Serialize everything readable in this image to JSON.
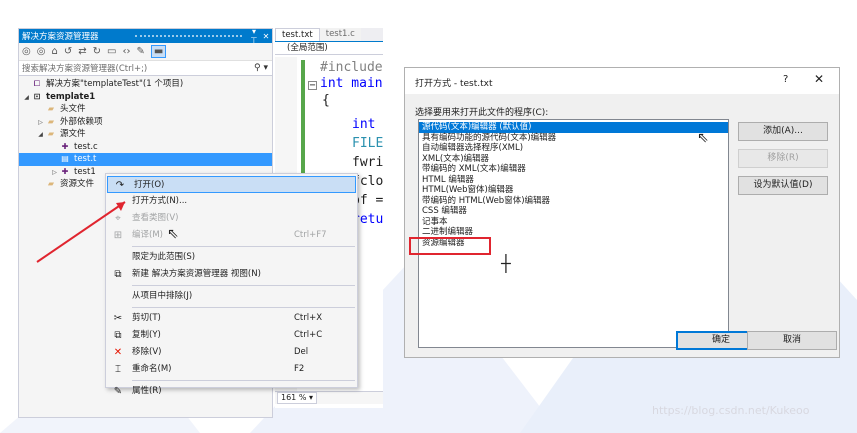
{
  "solution_explorer": {
    "title": "解决方案资源管理器",
    "pin_label": "▾ ⊤",
    "close_label": "✕",
    "search_placeholder": "搜索解决方案资源管理器(Ctrl+;)",
    "tree": [
      {
        "label": "解决方案\"templateTest\"(1 个项目)",
        "level": 0,
        "icon": "solution-icon",
        "expand": ""
      },
      {
        "label": "template1",
        "level": 0,
        "icon": "project-icon",
        "expand": "open",
        "bold": true
      },
      {
        "label": "头文件",
        "level": 1,
        "icon": "folder-icon",
        "expand": ""
      },
      {
        "label": "外部依赖项",
        "level": 1,
        "icon": "folder-icon",
        "expand": "closed"
      },
      {
        "label": "源文件",
        "level": 1,
        "icon": "folder-icon",
        "expand": "open"
      },
      {
        "label": "test.c",
        "level": 2,
        "icon": "c-file-icon",
        "expand": ""
      },
      {
        "label": "test.t",
        "level": 2,
        "icon": "text-file-icon",
        "expand": "",
        "selected": true
      },
      {
        "label": "test1",
        "level": 2,
        "icon": "c-file-icon",
        "expand": "closed"
      },
      {
        "label": "资源文件",
        "level": 1,
        "icon": "folder-icon",
        "expand": ""
      }
    ]
  },
  "editor": {
    "tabs": [
      {
        "label": "test.txt",
        "active": true
      },
      {
        "label": "test1.c",
        "active": false
      }
    ],
    "scope": "(全局范围)",
    "lines": [
      "#include",
      "int main",
      "{",
      "int",
      "FILE",
      "fwri",
      "fclo",
      "pf =",
      "retu"
    ],
    "zoom": "161 %"
  },
  "context_menu": {
    "items": [
      {
        "icon": "open-icon",
        "glyph": "↷",
        "label": "打开(O)",
        "shortcut": "",
        "state": "highlight"
      },
      {
        "icon": "",
        "glyph": "",
        "label": "打开方式(N)...",
        "shortcut": "",
        "state": "normal"
      },
      {
        "icon": "class-view-icon",
        "glyph": "⌖",
        "label": "查看类图(V)",
        "shortcut": "",
        "state": "disabled"
      },
      {
        "icon": "compile-icon",
        "glyph": "⊞",
        "label": "编译(M)",
        "shortcut": "Ctrl+F7",
        "state": "disabled"
      },
      {
        "sep": true
      },
      {
        "icon": "",
        "glyph": "",
        "label": "限定为此范围(S)",
        "shortcut": "",
        "state": "normal"
      },
      {
        "icon": "new-view-icon",
        "glyph": "⧉",
        "label": "新建 解决方案资源管理器 视图(N)",
        "shortcut": "",
        "state": "normal"
      },
      {
        "sep": true
      },
      {
        "icon": "",
        "glyph": "",
        "label": "从项目中排除(J)",
        "shortcut": "",
        "state": "normal"
      },
      {
        "sep": true
      },
      {
        "icon": "cut-icon",
        "glyph": "✂",
        "label": "剪切(T)",
        "shortcut": "Ctrl+X",
        "state": "normal"
      },
      {
        "icon": "copy-icon",
        "glyph": "⧉",
        "label": "复制(Y)",
        "shortcut": "Ctrl+C",
        "state": "normal"
      },
      {
        "icon": "delete-icon",
        "glyph": "✕",
        "label": "移除(V)",
        "shortcut": "Del",
        "state": "normal"
      },
      {
        "icon": "rename-icon",
        "glyph": "⌶",
        "label": "重命名(M)",
        "shortcut": "F2",
        "state": "normal"
      },
      {
        "sep": true
      },
      {
        "icon": "wrench-icon",
        "glyph": "✎",
        "label": "属性(R)",
        "shortcut": "",
        "state": "normal"
      }
    ]
  },
  "dialog": {
    "title": "打开方式 - test.txt",
    "help": "?",
    "close": "✕",
    "prompt": "选择要用来打开此文件的程序(C):",
    "programs": [
      {
        "label": "源代码(文本)编辑器 (默认值)",
        "selected": true
      },
      {
        "label": "具有编码功能的源代码(文本)编辑器",
        "selected": false
      },
      {
        "label": "自动编辑器选择程序(XML)",
        "selected": false
      },
      {
        "label": "XML(文本)编辑器",
        "selected": false
      },
      {
        "label": "带编码的 XML(文本)编辑器",
        "selected": false
      },
      {
        "label": "HTML 编辑器",
        "selected": false
      },
      {
        "label": "HTML(Web窗体)编辑器",
        "selected": false
      },
      {
        "label": "带编码的 HTML(Web窗体)编辑器",
        "selected": false
      },
      {
        "label": "CSS 编辑器",
        "selected": false
      },
      {
        "label": "记事本",
        "selected": false
      },
      {
        "label": "二进制编辑器",
        "selected": false
      },
      {
        "label": "资源编辑器",
        "selected": false
      }
    ],
    "buttons": {
      "add": "添加(A)...",
      "remove": "移除(R)",
      "set_default": "设为默认值(D)",
      "ok": "确定",
      "cancel": "取消"
    }
  },
  "watermark": "https://blog.csdn.net/Kukeoo",
  "colors": {
    "accent": "#007acc",
    "selection": "#3399ff",
    "list_selection": "#0078d7",
    "annotation": "#e0252f"
  }
}
